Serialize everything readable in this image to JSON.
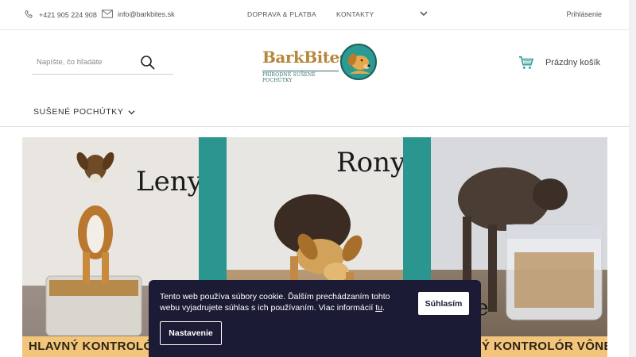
{
  "topbar": {
    "phone": "+421 905 224 908",
    "email": "info@barkbites.sk",
    "nav": [
      "DOPRAVA & PLATBA",
      "KONTAKTY"
    ],
    "login": "Prihlásenie"
  },
  "header": {
    "search_placeholder": "Napíšte, čo hľadáte",
    "logo_text": "BarkBites",
    "logo_tagline": "PRÍRODNÉ SUŠENÉ POCHÚTKY",
    "cart_label": "Prázdny košík",
    "category": "SUŠENÉ POCHÚTKY"
  },
  "banner": {
    "dogs": [
      "Leny",
      "Rony"
    ],
    "strip_left": "HLAVNÝ KONTROLÓR KV",
    "strip_right": "Ý KONTROLÓR VÔNE",
    "partial_letter": "e"
  },
  "cookie": {
    "message": "Tento web používa súbory cookie. Ďalším prechádzaním tohto webu vyjadrujete súhlas s ich používaním. Viac informácií ",
    "link": "tu",
    "after_link": ".",
    "accept": "Súhlasím",
    "settings": "Nastavenie"
  },
  "colors": {
    "teal": "#2a968f",
    "cookie_bg": "#1b1b35",
    "strip": "#f2c57a",
    "cart_icon": "#2a9a94"
  },
  "icons": [
    "phone-icon",
    "mail-icon",
    "chevron-down-icon",
    "search-icon",
    "cart-icon",
    "dog-logo-icon"
  ]
}
